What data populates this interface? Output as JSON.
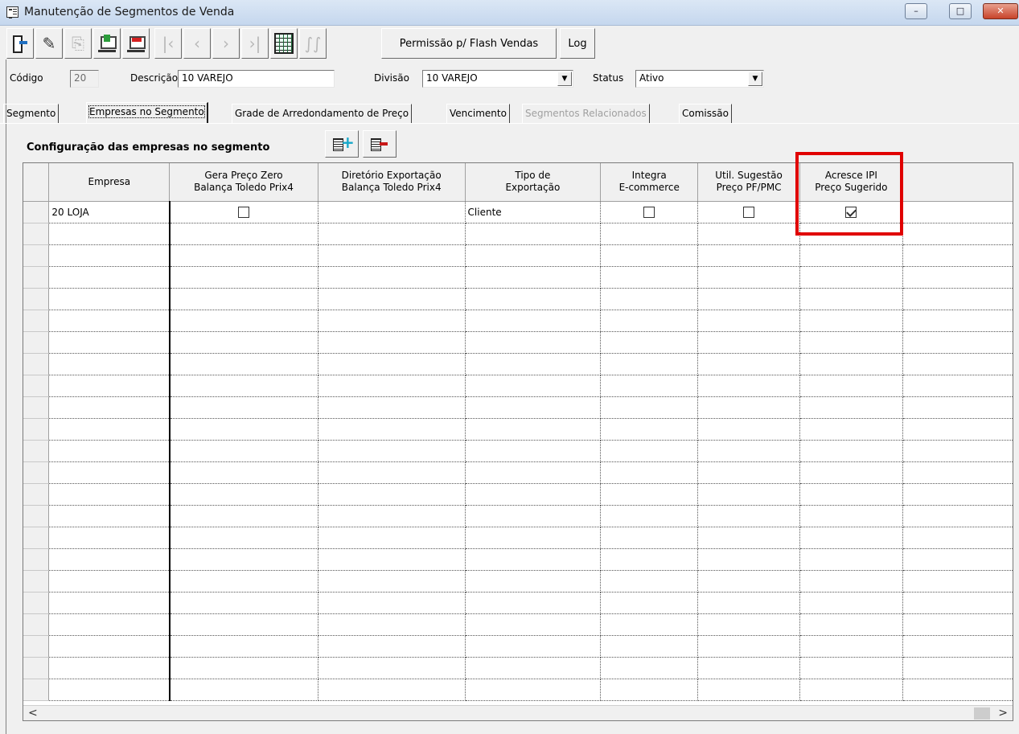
{
  "window": {
    "title": "Manutenção de Segmentos de Venda",
    "controls": {
      "minimize": "–",
      "maximize": "□",
      "close": "✕"
    }
  },
  "toolbar": {
    "buttons": [
      {
        "name": "exit",
        "icon": "exit-door-icon",
        "enabled": true
      },
      {
        "name": "edit",
        "icon": "pencil-icon",
        "enabled": true
      },
      {
        "name": "add-disabled",
        "icon": "new-record-icon",
        "enabled": false
      },
      {
        "name": "save",
        "icon": "save-icon",
        "enabled": true
      },
      {
        "name": "cancel",
        "icon": "cancel-icon",
        "enabled": true
      },
      {
        "name": "first",
        "icon": "first-record-icon",
        "enabled": false
      },
      {
        "name": "previous",
        "icon": "previous-record-icon",
        "enabled": false
      },
      {
        "name": "next",
        "icon": "next-record-icon",
        "enabled": false
      },
      {
        "name": "last",
        "icon": "last-record-icon",
        "enabled": false
      },
      {
        "name": "grid-view",
        "icon": "grid-icon",
        "enabled": true
      },
      {
        "name": "search-disabled",
        "icon": "binoculars-icon",
        "enabled": false
      }
    ],
    "permission_label": "Permissão p/ Flash Vendas",
    "log_label": "Log"
  },
  "header": {
    "code_label": "Código",
    "code_value": "20",
    "description_label": "Descrição",
    "description_value": "10 VAREJO",
    "division_label": "Divisão",
    "division_value": "10 VAREJO",
    "status_label": "Status",
    "status_value": "Ativo"
  },
  "tabs": [
    {
      "label": "Segmento",
      "state": "normal"
    },
    {
      "label": "Empresas no Segmento",
      "state": "active"
    },
    {
      "label": "Grade de Arredondamento de Preço",
      "state": "normal"
    },
    {
      "label": "Vencimento",
      "state": "normal"
    },
    {
      "label": "Segmentos Relacionados",
      "state": "disabled"
    },
    {
      "label": "Comissão",
      "state": "normal"
    }
  ],
  "section": {
    "title": "Configuração das empresas no segmento",
    "add_icon": "add-company-icon",
    "remove_icon": "remove-company-icon"
  },
  "grid": {
    "columns": [
      "Empresa",
      "Gera Preço Zero\nBalança Toledo Prix4",
      "Diretório Exportação\nBalança Toledo Prix4",
      "Tipo de\nExportação",
      "Integra\nE-commerce",
      "Util. Sugestão\nPreço PF/PMC",
      "Acresce IPI\nPreço Sugerido"
    ],
    "rows": [
      {
        "empresa": "20 LOJA",
        "gera_preco_zero": false,
        "diretorio": "",
        "tipo_exportacao": "Cliente",
        "integra_ecommerce": false,
        "util_sugestao": false,
        "acresce_ipi": true
      }
    ],
    "empty_rows": 22,
    "scroll_left": "<",
    "scroll_right": ">"
  },
  "colors": {
    "highlight": "#e00000",
    "window_bg": "#f0f0f0",
    "title_gradient_top": "#dbe7f5"
  }
}
